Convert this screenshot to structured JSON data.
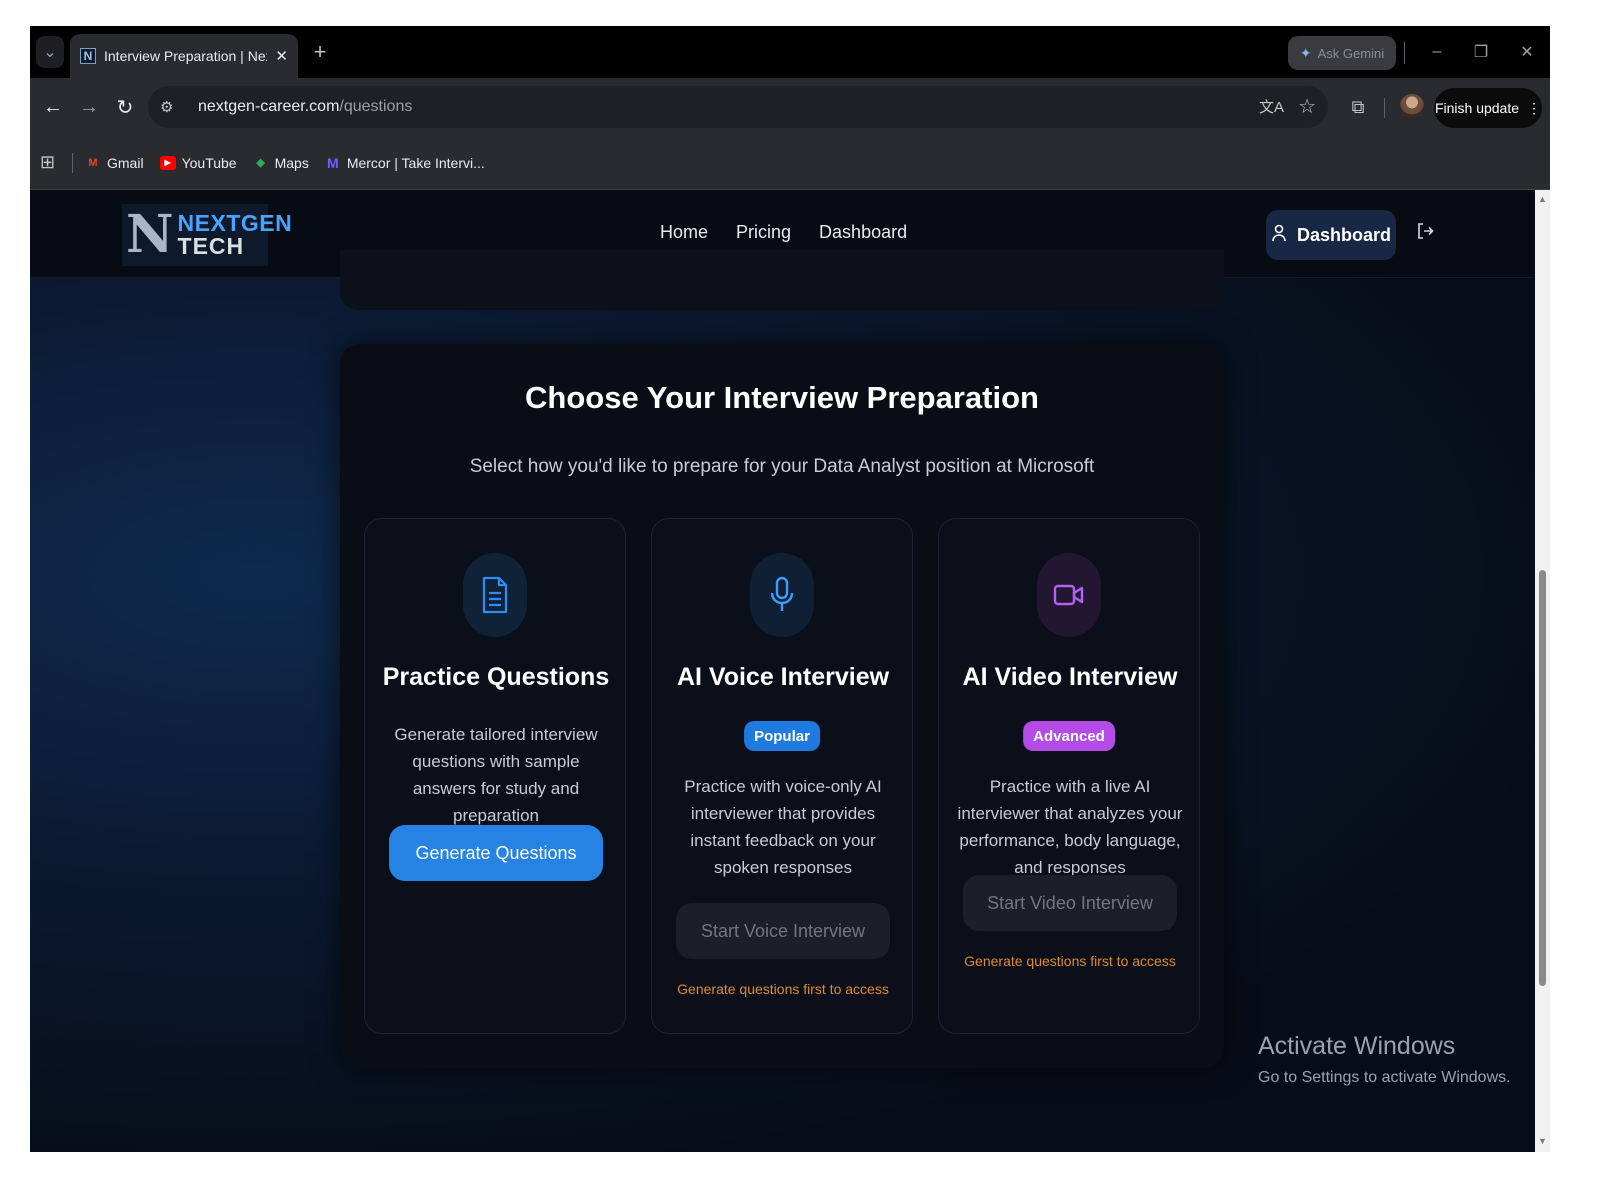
{
  "browser": {
    "tab_title": "Interview Preparation | NextGen",
    "tab_favicon_letter": "N",
    "ask_gemini": "Ask Gemini",
    "url_host": "nextgen-career.com",
    "url_path": "/questions",
    "finish_update": "Finish update",
    "bookmarks": [
      {
        "label": "Gmail",
        "icon": "gmail-icon",
        "color": "#ea4335"
      },
      {
        "label": "YouTube",
        "icon": "youtube-icon",
        "color": "#ff0000"
      },
      {
        "label": "Maps",
        "icon": "maps-icon",
        "color": "#34a853"
      },
      {
        "label": "Mercor | Take Intervi...",
        "icon": "mercor-icon",
        "color": "#6d5dfc"
      }
    ]
  },
  "site": {
    "logo_top": "NEXTGEN",
    "logo_bottom": "TECH",
    "nav": {
      "home": "Home",
      "pricing": "Pricing",
      "dashboard": "Dashboard"
    },
    "dashboard_button": "Dashboard"
  },
  "main": {
    "title": "Choose Your Interview Preparation",
    "subtitle": "Select how you'd like to prepare for your Data Analyst position at Microsoft",
    "options": [
      {
        "icon": "document-icon",
        "accent": "#2f8cf0",
        "title": "Practice Questions",
        "description": "Generate tailored interview questions with sample answers for study and preparation",
        "button": "Generate Questions",
        "button_enabled": true
      },
      {
        "icon": "microphone-icon",
        "accent": "#3b9cff",
        "title": "AI Voice Interview",
        "badge": "Popular",
        "badge_color": "#1f7ae0",
        "description": "Practice with voice-only AI interviewer that provides instant feedback on your spoken responses",
        "button": "Start Voice Interview",
        "button_enabled": false,
        "note": "Generate questions first to access"
      },
      {
        "icon": "video-camera-icon",
        "accent": "#b460f0",
        "title": "AI Video Interview",
        "badge": "Advanced",
        "badge_color": "#b44be6",
        "description": "Practice with a live AI interviewer that analyzes your performance, body language, and responses",
        "button": "Start Video Interview",
        "button_enabled": false,
        "note": "Generate questions first to access"
      }
    ]
  },
  "os": {
    "activate_title": "Activate Windows",
    "activate_sub": "Go to Settings to activate Windows."
  }
}
